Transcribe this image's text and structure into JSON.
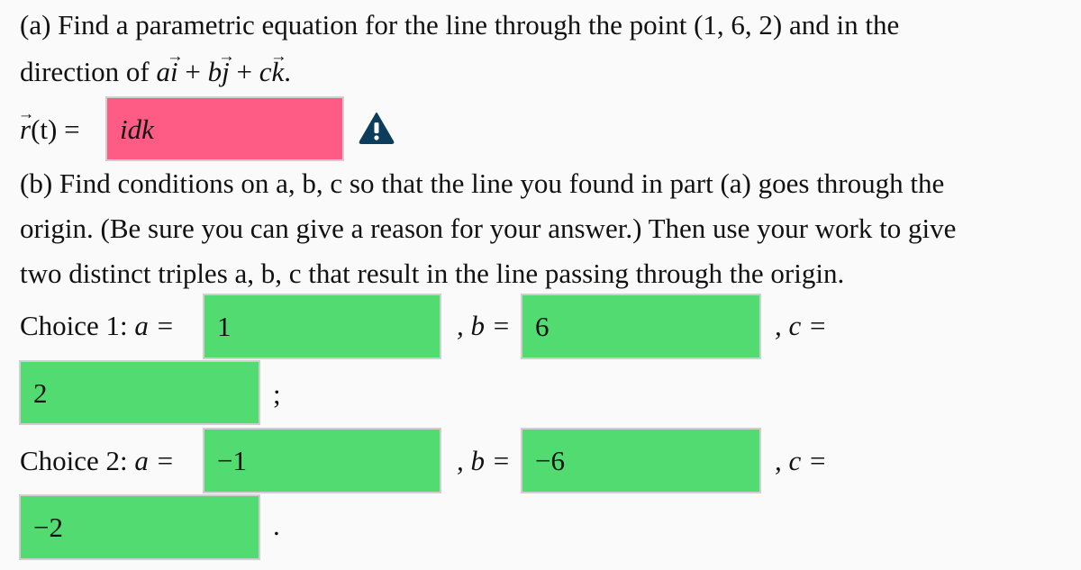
{
  "part_a": {
    "line1": "(a) Find a parametric equation for the line through the point (1, 6, 2) and in the",
    "line2_prefix": "direction of ",
    "direction_terms": [
      {
        "coef": "a",
        "unit": "i"
      },
      {
        "coef": "b",
        "unit": "j"
      },
      {
        "coef": "c",
        "unit": "k"
      }
    ],
    "plus": " + ",
    "period": ".",
    "answer_label_vec": "r",
    "answer_label_rest": "(t) =",
    "answer_value": "idk",
    "answer_status": "incorrect",
    "status_icon": "warning-icon"
  },
  "part_b": {
    "line1": "(b) Find conditions on a, b, c so that the line you found in part (a) goes through the",
    "line2": "origin. (Be sure you can give a reason for your answer.) Then use your work to give",
    "line3": "two distinct triples a, b, c that result in the line passing through the origin."
  },
  "choices": [
    {
      "label": "Choice 1: ",
      "a_label": "a =",
      "a": "1",
      "b_label": ", b =",
      "b": "6",
      "c_label": ", c =",
      "c": "2",
      "terminator": ";"
    },
    {
      "label": "Choice 2: ",
      "a_label": "a =",
      "a": "−1",
      "b_label": ", b =",
      "b": "−6",
      "c_label": ", c =",
      "c": "−2",
      "terminator": "."
    }
  ],
  "colors": {
    "correct": "#52db70",
    "incorrect": "#ff5c85",
    "warning_icon": "#0d3d5c",
    "background": "#fafafa"
  }
}
